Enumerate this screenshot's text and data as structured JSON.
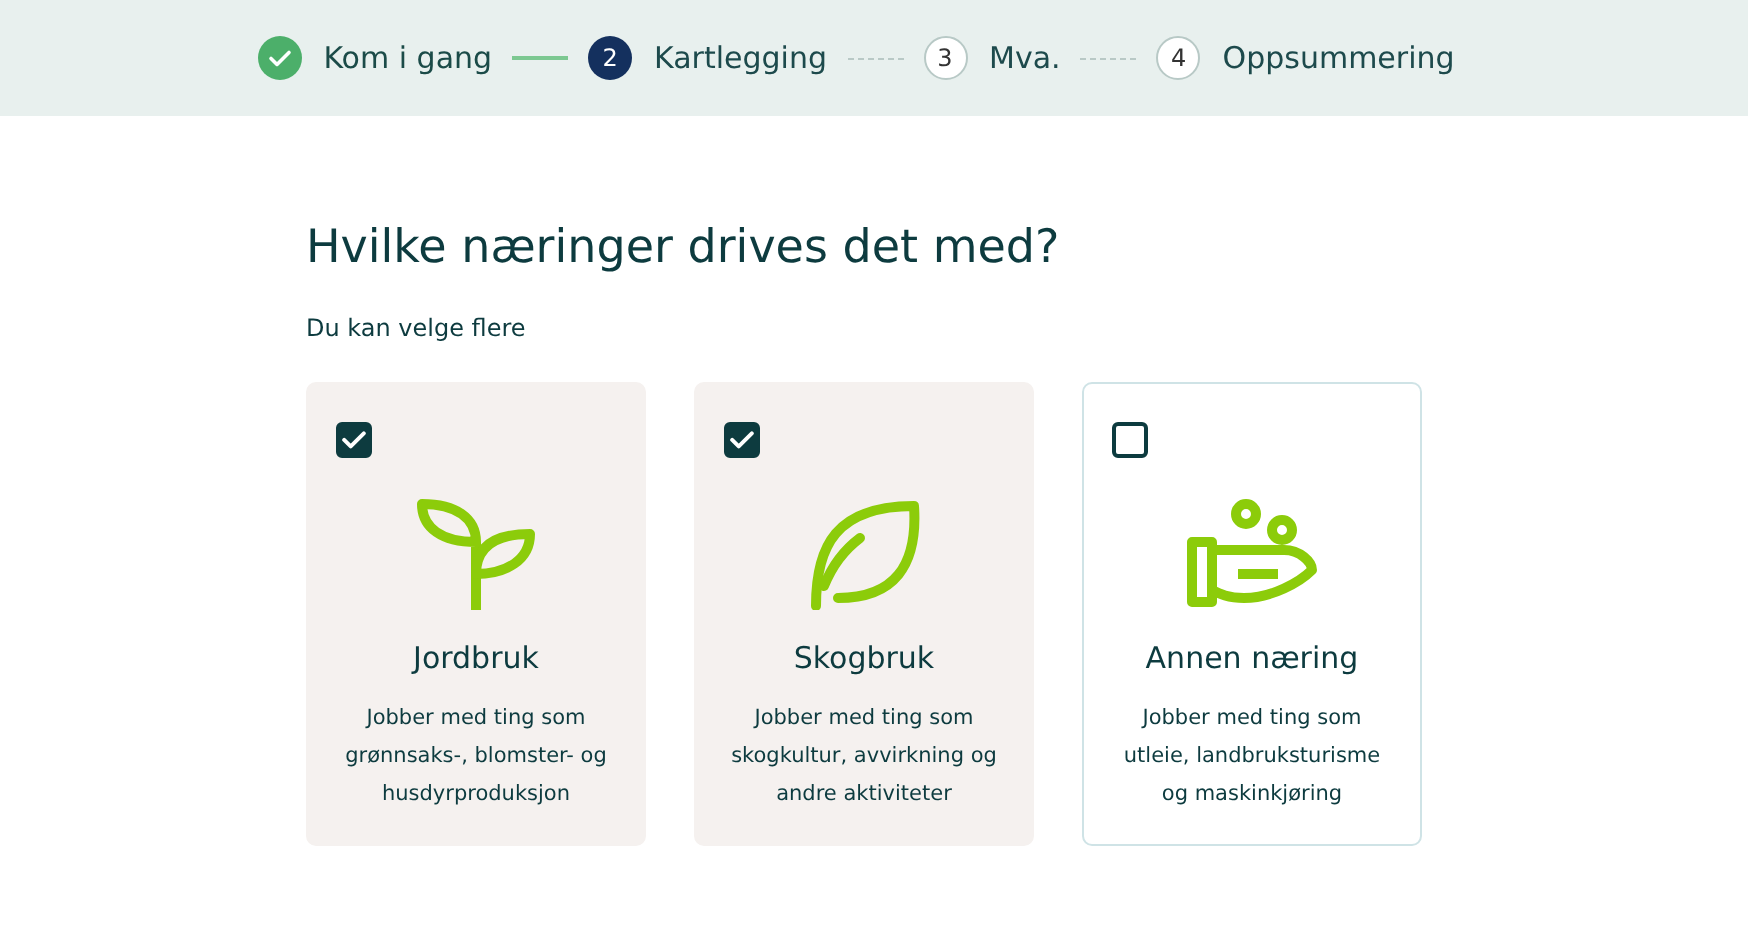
{
  "steps": [
    {
      "label": "Kom i gang",
      "completed": true,
      "selected": false
    },
    {
      "number": "2",
      "label": "Kartlegging",
      "completed": false,
      "selected": true
    },
    {
      "number": "3",
      "label": "Mva.",
      "completed": false,
      "selected": false
    },
    {
      "number": "4",
      "label": "Oppsummering",
      "completed": false,
      "selected": false
    }
  ],
  "heading": "Hvilke næringer drives det med?",
  "hint": "Du kan velge flere",
  "options": [
    {
      "kind": "sprout",
      "title": "Jordbruk",
      "description": "Jobber med ting som grønnsaks-, blomster- og husdyrproduksjon",
      "checked": true
    },
    {
      "kind": "leaf",
      "title": "Skogbruk",
      "description": "Jobber med ting som skogkultur, avvirkning og andre aktiviteter",
      "checked": true
    },
    {
      "kind": "hand",
      "title": "Annen næring",
      "description": "Jobber med ting som utleie, landbruksturisme og maskinkjøring",
      "checked": false
    }
  ]
}
